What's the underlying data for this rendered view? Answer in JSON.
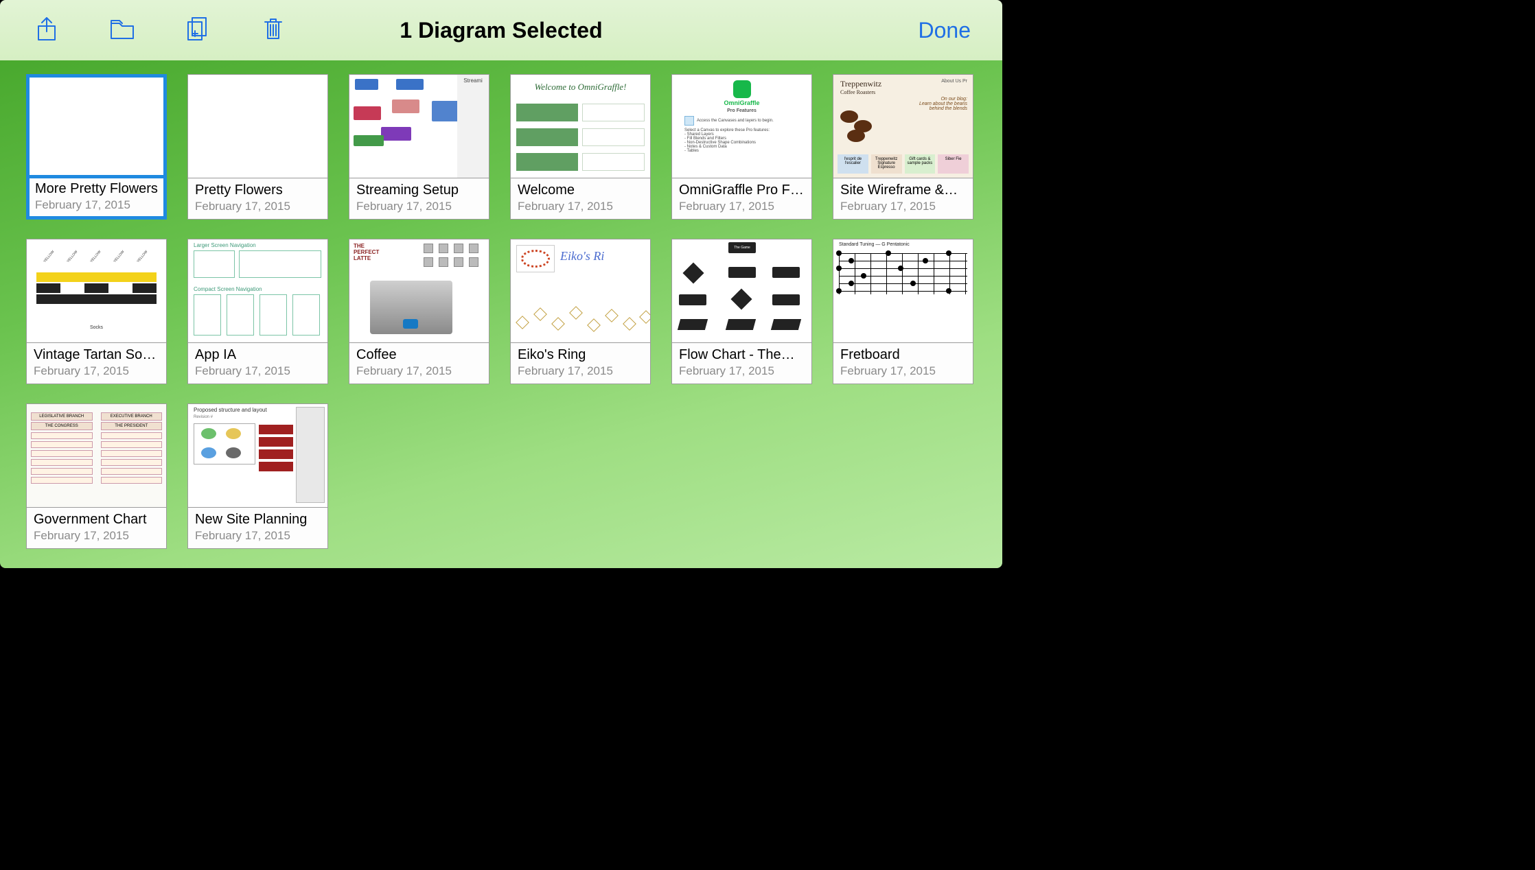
{
  "toolbar": {
    "title": "1 Diagram Selected",
    "done_label": "Done"
  },
  "documents": [
    {
      "title": "More Pretty Flowers",
      "date": "February 17, 2015",
      "selected": true,
      "preview": "blank"
    },
    {
      "title": "Pretty Flowers",
      "date": "February 17, 2015",
      "selected": false,
      "preview": "blank"
    },
    {
      "title": "Streaming Setup",
      "date": "February 17, 2015",
      "selected": false,
      "preview": "flow",
      "preview_text": {
        "side_title": "Streami"
      }
    },
    {
      "title": "Welcome",
      "date": "February 17, 2015",
      "selected": false,
      "preview": "welcome",
      "preview_text": {
        "heading": "Welcome to OmniGraffle!"
      }
    },
    {
      "title": "OmniGraffle Pro F…",
      "date": "February 17, 2015",
      "selected": false,
      "preview": "pro",
      "preview_text": {
        "brand": "OmniGraffle",
        "sub": "Pro Features",
        "line1": "Access the Canvases and layers to begin.",
        "line2": "Select a Canvas to explore these Pro features:",
        "b1": "Shared Layers",
        "b2": "Fill Blends and Filters",
        "b3": "Non-Destructive Shape Combinations",
        "b4": "Notes & Custom Data",
        "b5": "Tables"
      }
    },
    {
      "title": "Site Wireframe &…",
      "date": "February 17, 2015",
      "selected": false,
      "preview": "site",
      "preview_text": {
        "brand": "Treppenwitz",
        "sub": "Coffee Roasters",
        "right": "About Us    Pr",
        "blurb1": "On our blog:",
        "blurb2": "Learn about the beans",
        "blurb3": "behind the blends",
        "t1": "l'esprit de l'escalier",
        "t2": "Treppenwitz Signature Espresso",
        "t3": "Gift cards & sample packs",
        "t4": "Siber Fie"
      }
    },
    {
      "title": "Vintage Tartan So…",
      "date": "February 17, 2015",
      "selected": false,
      "preview": "tartan",
      "preview_text": {
        "axis": "Socks"
      }
    },
    {
      "title": "App IA",
      "date": "February 17, 2015",
      "selected": false,
      "preview": "ia",
      "preview_text": {
        "t1": "Larger Screen Navigation",
        "t2": "Compact Screen Navigation"
      }
    },
    {
      "title": "Coffee",
      "date": "February 17, 2015",
      "selected": false,
      "preview": "coffee",
      "preview_text": {
        "line1": "THE",
        "line2": "PERFECT",
        "line3": "LATTE"
      }
    },
    {
      "title": "Eiko's Ring",
      "date": "February 17, 2015",
      "selected": false,
      "preview": "eiko",
      "preview_text": {
        "title": "Eiko's Ri"
      }
    },
    {
      "title": "Flow Chart - The…",
      "date": "February 17, 2015",
      "selected": false,
      "preview": "flowgame",
      "preview_text": {
        "n1": "The Game"
      }
    },
    {
      "title": "Fretboard",
      "date": "February 17, 2015",
      "selected": false,
      "preview": "fret",
      "preview_text": {
        "title": "Standard Tuning — G Pentatonic"
      }
    },
    {
      "title": "Government Chart",
      "date": "February 17, 2015",
      "selected": false,
      "preview": "gov",
      "preview_text": {
        "h1": "LEGISLATIVE BRANCH",
        "h1b": "THE CONGRESS",
        "h2": "EXECUTIVE BRANCH",
        "h2b": "THE PRESIDENT"
      }
    },
    {
      "title": "New Site Planning",
      "date": "February 17, 2015",
      "selected": false,
      "preview": "plan",
      "preview_text": {
        "title": "Proposed structure and layout",
        "sub": "Revision #"
      }
    }
  ]
}
